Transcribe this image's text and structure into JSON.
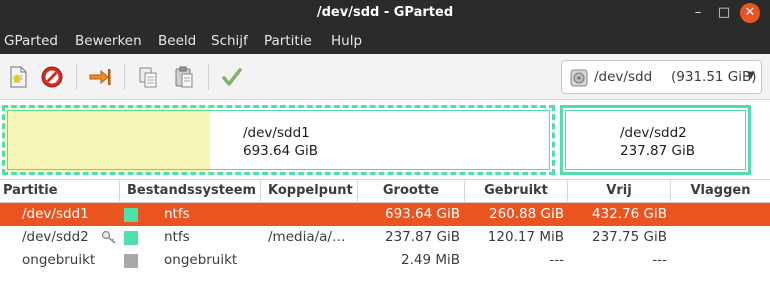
{
  "window": {
    "title": "/dev/sdd - GParted"
  },
  "menu": [
    "GParted",
    "Bewerken",
    "Beeld",
    "Schijf",
    "Partitie",
    "Hulp"
  ],
  "device": {
    "name": "/dev/sdd",
    "size": "(931.51 GiB)"
  },
  "disk_map": {
    "partitions": [
      {
        "name": "/dev/sdd1",
        "size": "693.64 GiB"
      },
      {
        "name": "/dev/sdd2",
        "size": "237.87 GiB"
      }
    ]
  },
  "table": {
    "columns": [
      "Partitie",
      "Bestandssysteem",
      "Koppelpunt",
      "Grootte",
      "Gebruikt",
      "Vrij",
      "Vlaggen"
    ],
    "rows": [
      {
        "partition": "/dev/sdd1",
        "fs": "ntfs",
        "fs_color": "#4ee0a8",
        "mount": "",
        "size": "693.64 GiB",
        "used": "260.88 GiB",
        "free": "432.76 GiB",
        "flags": ""
      },
      {
        "partition": "/dev/sdd2",
        "fs": "ntfs",
        "fs_color": "#4ee0a8",
        "mount": "/media/a/…",
        "size": "237.87 GiB",
        "used": "120.17 MiB",
        "free": "237.75 GiB",
        "flags": ""
      },
      {
        "partition": "ongebruikt",
        "fs": "ongebruikt",
        "fs_color": "#a8a8a8",
        "mount": "",
        "size": "2.49 MiB",
        "used": "---",
        "free": "---",
        "flags": ""
      }
    ]
  },
  "colors": {
    "accent": "#e95420",
    "ntfs": "#4ee0a8",
    "unallocated": "#a8a8a8",
    "used_space": "#f6f6b8"
  }
}
